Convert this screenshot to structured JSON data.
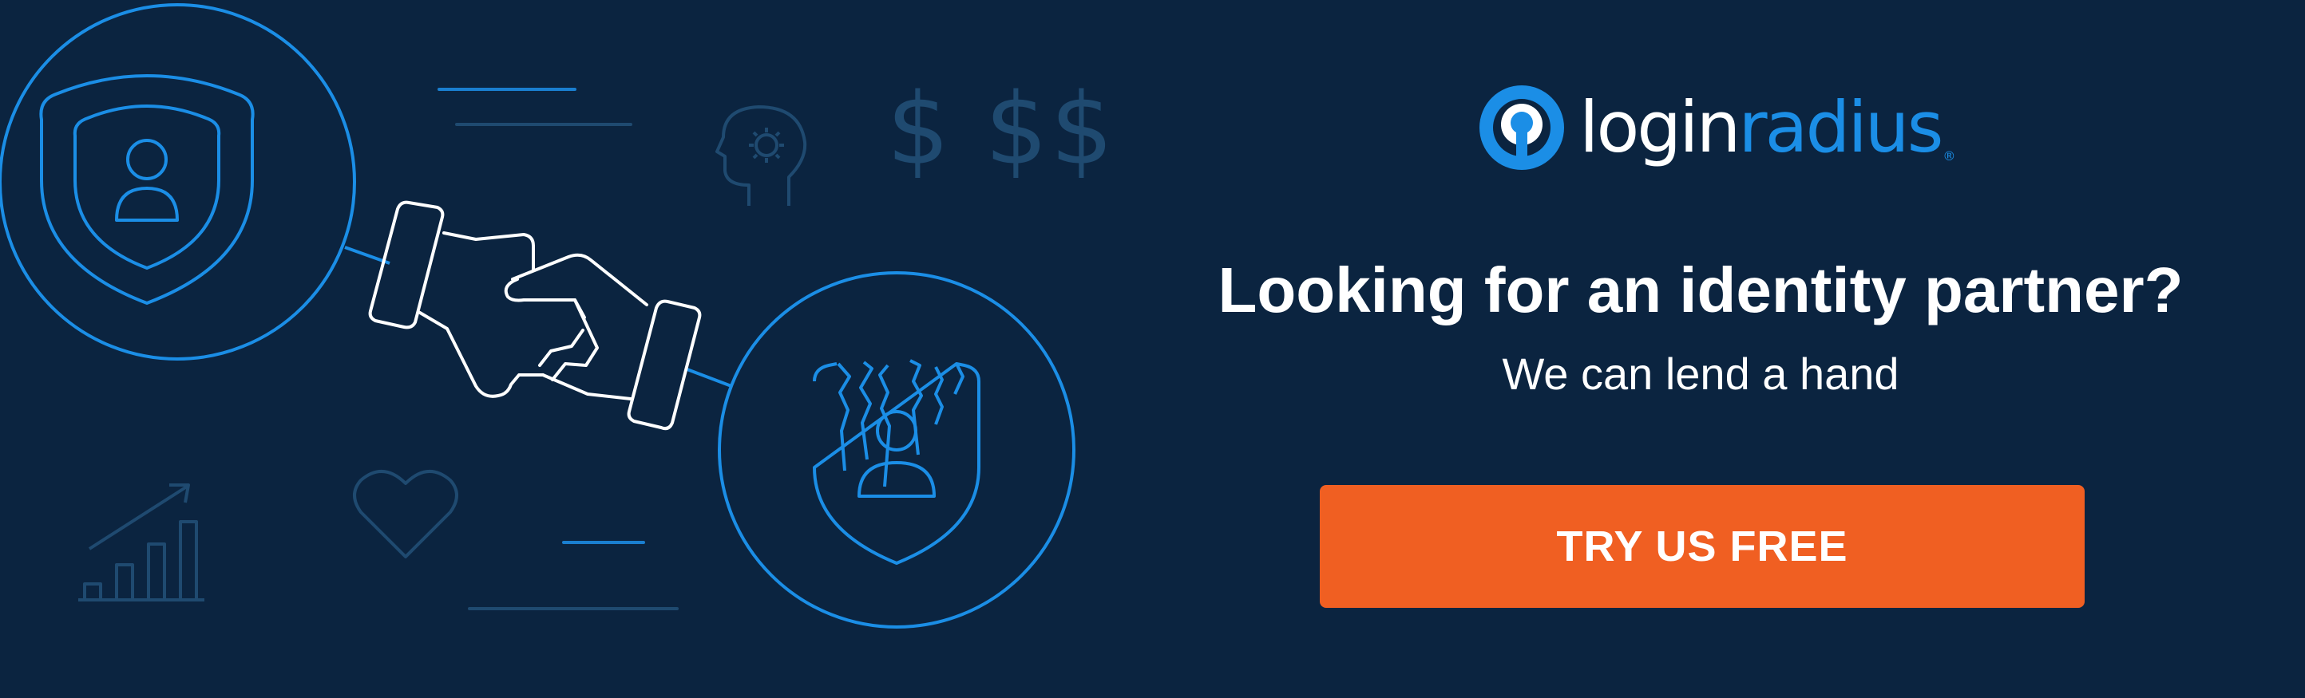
{
  "logo": {
    "text_login": "login",
    "text_radius": "radius",
    "registered": "®"
  },
  "headline": "Looking for an identity partner?",
  "subline": "We can lend a hand",
  "cta": {
    "label": "TRY US FREE"
  },
  "illustration": {
    "currency_symbols": [
      "$",
      "$",
      "$"
    ],
    "icons": [
      "shield-user-icon",
      "handshake-icon",
      "cracked-shield-user-icon",
      "brain-gear-head-icon",
      "dollar-icon",
      "growth-chart-icon",
      "heart-icon"
    ]
  },
  "colors": {
    "background": "#0b2440",
    "accent_blue": "#1b8ee6",
    "muted_blue": "#1f4a70",
    "cta_orange": "#f05f22",
    "text": "#ffffff"
  }
}
